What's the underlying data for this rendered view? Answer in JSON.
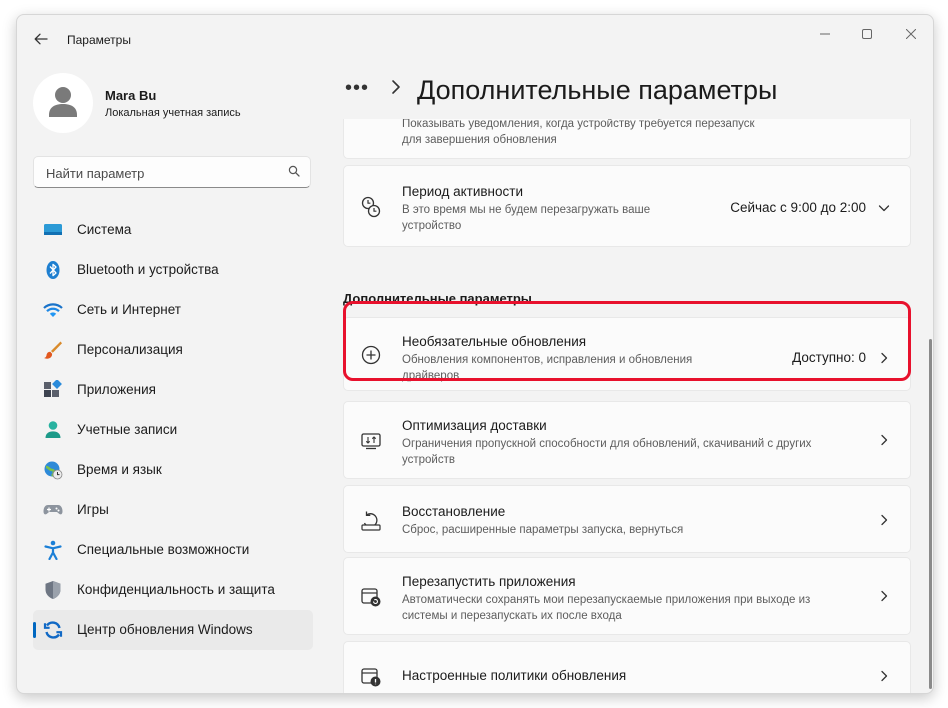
{
  "window": {
    "title": "Параметры",
    "controls": [
      "minimize-icon",
      "maximize-icon",
      "close-icon"
    ]
  },
  "user": {
    "name": "Mara Bu",
    "account_type": "Локальная учетная запись"
  },
  "search": {
    "placeholder": "Найти параметр"
  },
  "sidebar": {
    "items": [
      {
        "label": "Система",
        "icon": "monitor-icon"
      },
      {
        "label": "Bluetooth и устройства",
        "icon": "bluetooth-icon"
      },
      {
        "label": "Сеть и Интернет",
        "icon": "wifi-icon"
      },
      {
        "label": "Персонализация",
        "icon": "brush-icon"
      },
      {
        "label": "Приложения",
        "icon": "apps-icon"
      },
      {
        "label": "Учетные записи",
        "icon": "person-icon"
      },
      {
        "label": "Время и язык",
        "icon": "globe-clock-icon"
      },
      {
        "label": "Игры",
        "icon": "gamepad-icon"
      },
      {
        "label": "Специальные возможности",
        "icon": "accessibility-icon"
      },
      {
        "label": "Конфиденциальность и защита",
        "icon": "shield-icon"
      },
      {
        "label": "Центр обновления Windows",
        "icon": "windows-update-icon",
        "selected": true
      }
    ]
  },
  "breadcrumb": {
    "ellipsis": "•••",
    "title": "Дополнительные параметры"
  },
  "content": {
    "partial_card": {
      "desc_line1": "Показывать уведомления, когда устройству требуется перезапуск",
      "desc_line2": "для завершения обновления"
    },
    "active_hours": {
      "title": "Период активности",
      "desc": "В это время мы не будем перезагружать ваше устройство",
      "value": "Сейчас с 9:00 до 2:00"
    },
    "section_title": "Дополнительные параметры",
    "cards": [
      {
        "title": "Необязательные обновления",
        "desc": "Обновления компонентов, исправления и обновления драйверов",
        "value": "Доступно: 0",
        "icon": "plus-circle-icon"
      },
      {
        "title": "Оптимизация доставки",
        "desc": "Ограничения пропускной способности для обновлений, скачиваний с других устройств",
        "value": "",
        "icon": "delivery-optimization-icon"
      },
      {
        "title": "Восстановление",
        "desc": "Сброс, расширенные параметры запуска, вернуться",
        "value": "",
        "icon": "recovery-icon"
      },
      {
        "title": "Перезапустить приложения",
        "desc": "Автоматически сохранять мои перезапускаемые приложения при выходе из системы и перезапускать их после входа",
        "value": "",
        "icon": "restart-apps-icon"
      },
      {
        "title": "Настроенные политики обновления",
        "desc": "",
        "value": "",
        "icon": "update-policy-icon"
      }
    ]
  },
  "colors": {
    "accent": "#0067c0",
    "highlight": "#e8112d",
    "background": "#f3f3f3",
    "card": "#fbfbfb"
  }
}
